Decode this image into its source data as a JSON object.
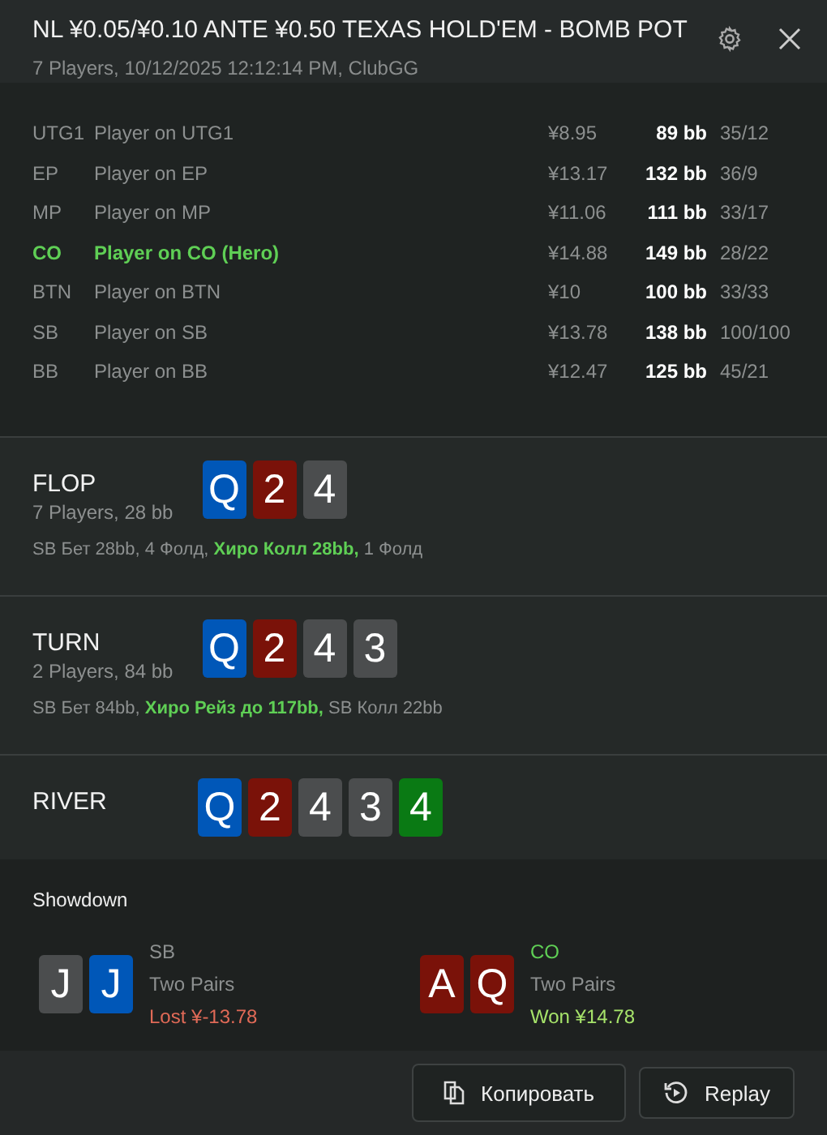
{
  "header": {
    "title": "NL ¥0.05/¥0.10 ANTE ¥0.50 TEXAS HOLD'EM - BOMB POT",
    "subtitle": "7 Players, 10/12/2025 12:12:14 PM, ClubGG"
  },
  "players": [
    {
      "position": "UTG1",
      "name": "Player on UTG1",
      "stack": "¥8.95",
      "bb": "89 bb",
      "stats": "35/12",
      "hero": false
    },
    {
      "position": "EP",
      "name": "Player on EP",
      "stack": "¥13.17",
      "bb": "132 bb",
      "stats": "36/9",
      "hero": false
    },
    {
      "position": "MP",
      "name": "Player on MP",
      "stack": "¥11.06",
      "bb": "111 bb",
      "stats": "33/17",
      "hero": false
    },
    {
      "position": "CO",
      "name": "Player on CO (Hero)",
      "stack": "¥14.88",
      "bb": "149 bb",
      "stats": "28/22",
      "hero": true
    },
    {
      "position": "BTN",
      "name": "Player on BTN",
      "stack": "¥10",
      "bb": "100 bb",
      "stats": "33/33",
      "hero": false
    },
    {
      "position": "SB",
      "name": "Player on SB",
      "stack": "¥13.78",
      "bb": "138 bb",
      "stats": "100/100",
      "hero": false
    },
    {
      "position": "BB",
      "name": "Player on BB",
      "stack": "¥12.47",
      "bb": "125 bb",
      "stats": "45/21",
      "hero": false
    }
  ],
  "streets": [
    {
      "name": "FLOP",
      "info": "7 Players, 28 bb",
      "cards": [
        {
          "rank": "Q",
          "color": "#0057b8"
        },
        {
          "rank": "2",
          "color": "#7a1209"
        },
        {
          "rank": "4",
          "color": "#4b4d4e"
        }
      ],
      "actions": "SB Бет 28bb, 4 Фолд, **Хиро Колл 28bb,** 1 Фолд"
    },
    {
      "name": "TURN",
      "info": "2 Players, 84 bb",
      "cards": [
        {
          "rank": "Q",
          "color": "#0057b8"
        },
        {
          "rank": "2",
          "color": "#7a1209"
        },
        {
          "rank": "4",
          "color": "#4b4d4e"
        },
        {
          "rank": "3",
          "color": "#4b4d4e"
        }
      ],
      "actions": "SB Бет 84bb, **Хиро Рейз до 117bb,** SB Колл 22bb"
    },
    {
      "name": "RIVER",
      "cards": [
        {
          "rank": "Q",
          "color": "#0057b8"
        },
        {
          "rank": "2",
          "color": "#7a1209"
        },
        {
          "rank": "4",
          "color": "#4b4d4e"
        },
        {
          "rank": "3",
          "color": "#4b4d4e"
        },
        {
          "rank": "4",
          "color": "#0a7a14"
        }
      ]
    }
  ],
  "showdown": {
    "title": "Showdown",
    "hands": [
      {
        "cards": [
          {
            "rank": "J",
            "color": "#4b4d4e"
          },
          {
            "rank": "J",
            "color": "#0057b8"
          }
        ],
        "position": "SB",
        "hero": false,
        "hand": "Two Pairs",
        "result": "Lost ¥-13.78",
        "won": false
      },
      {
        "cards": [
          {
            "rank": "A",
            "color": "#7a1209"
          },
          {
            "rank": "Q",
            "color": "#7a1209"
          }
        ],
        "position": "CO",
        "hero": true,
        "hand": "Two Pairs",
        "result": "Won ¥14.78",
        "won": true
      }
    ]
  },
  "buttons": [
    {
      "kind": "copy",
      "label": "Копировать"
    },
    {
      "kind": "replay",
      "label": "Replay"
    }
  ]
}
